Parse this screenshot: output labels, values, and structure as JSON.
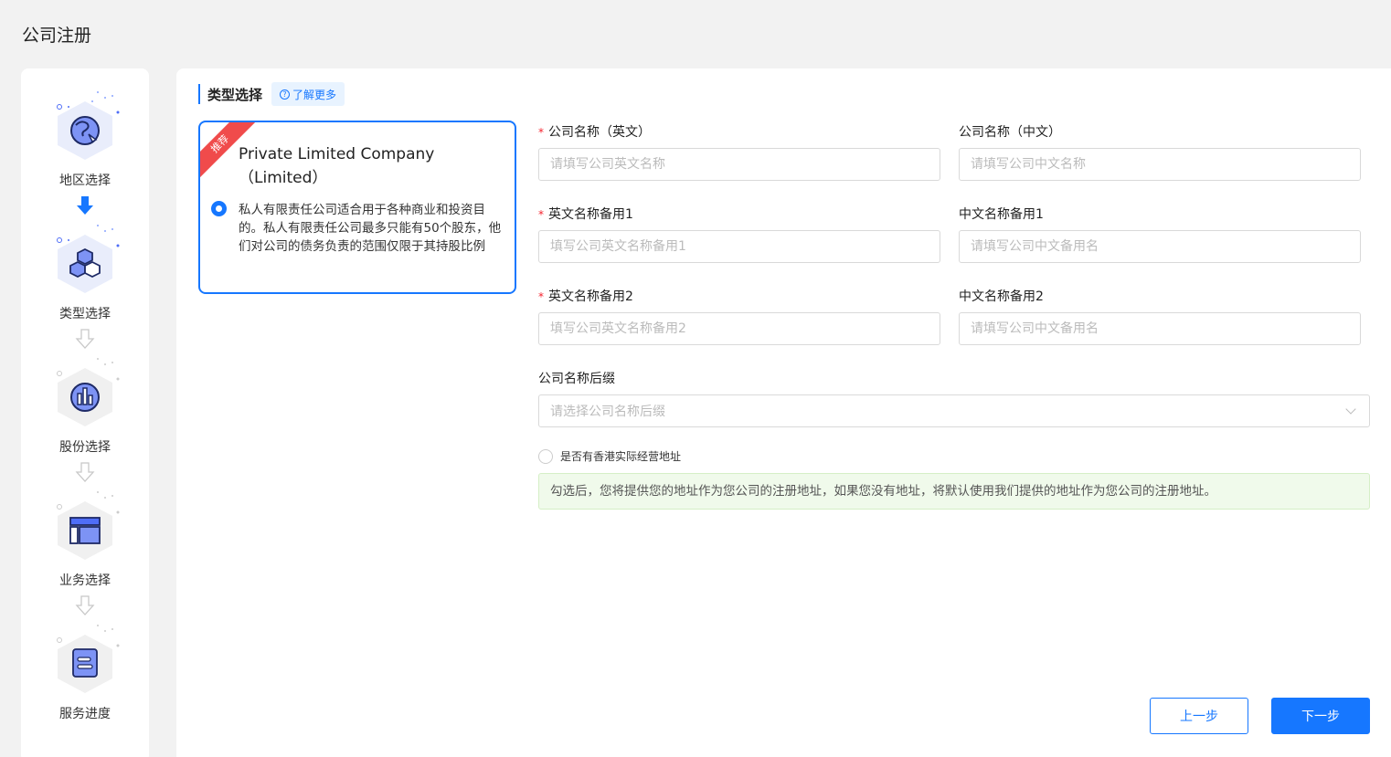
{
  "page": {
    "title": "公司注册"
  },
  "steps": [
    {
      "label": "地区选择",
      "icon": "globe-icon",
      "state": "done"
    },
    {
      "label": "类型选择",
      "icon": "hexagons-icon",
      "state": "active"
    },
    {
      "label": "股份选择",
      "icon": "bar-chart-icon",
      "state": "pending"
    },
    {
      "label": "业务选择",
      "icon": "layout-icon",
      "state": "pending"
    },
    {
      "label": "服务进度",
      "icon": "document-icon",
      "state": "pending"
    }
  ],
  "section": {
    "title": "类型选择",
    "learn_more": "了解更多"
  },
  "type_card": {
    "ribbon": "推荐",
    "title_line1": "Private Limited Company",
    "title_line2": "（Limited）",
    "description": "私人有限责任公司适合用于各种商业和投资目的。私人有限责任公司最多只能有50个股东，他们对公司的债务负责的范围仅限于其持股比例",
    "selected": true
  },
  "form": {
    "en_name": {
      "label": "公司名称（英文）",
      "placeholder": "请填写公司英文名称",
      "required": true
    },
    "cn_name": {
      "label": "公司名称（中文）",
      "placeholder": "请填写公司中文名称",
      "required": false
    },
    "en_alt1": {
      "label": "英文名称备用1",
      "placeholder": "填写公司英文名称备用1",
      "required": true
    },
    "cn_alt1": {
      "label": "中文名称备用1",
      "placeholder": "请填写公司中文备用名",
      "required": false
    },
    "en_alt2": {
      "label": "英文名称备用2",
      "placeholder": "填写公司英文名称备用2",
      "required": true
    },
    "cn_alt2": {
      "label": "中文名称备用2",
      "placeholder": "请填写公司中文备用名",
      "required": false
    },
    "suffix": {
      "label": "公司名称后缀",
      "placeholder": "请选择公司名称后缀"
    },
    "hk_address": {
      "label": "是否有香港实际经营地址",
      "checked": false
    },
    "notice": "勾选后，您将提供您的地址作为您公司的注册地址，如果您没有地址，将默认使用我们提供的地址作为您公司的注册地址。"
  },
  "buttons": {
    "prev": "上一步",
    "next": "下一步"
  },
  "colors": {
    "accent": "#1677ff",
    "ribbon": "#f04b4b",
    "notice_bg": "#f0faeb"
  }
}
